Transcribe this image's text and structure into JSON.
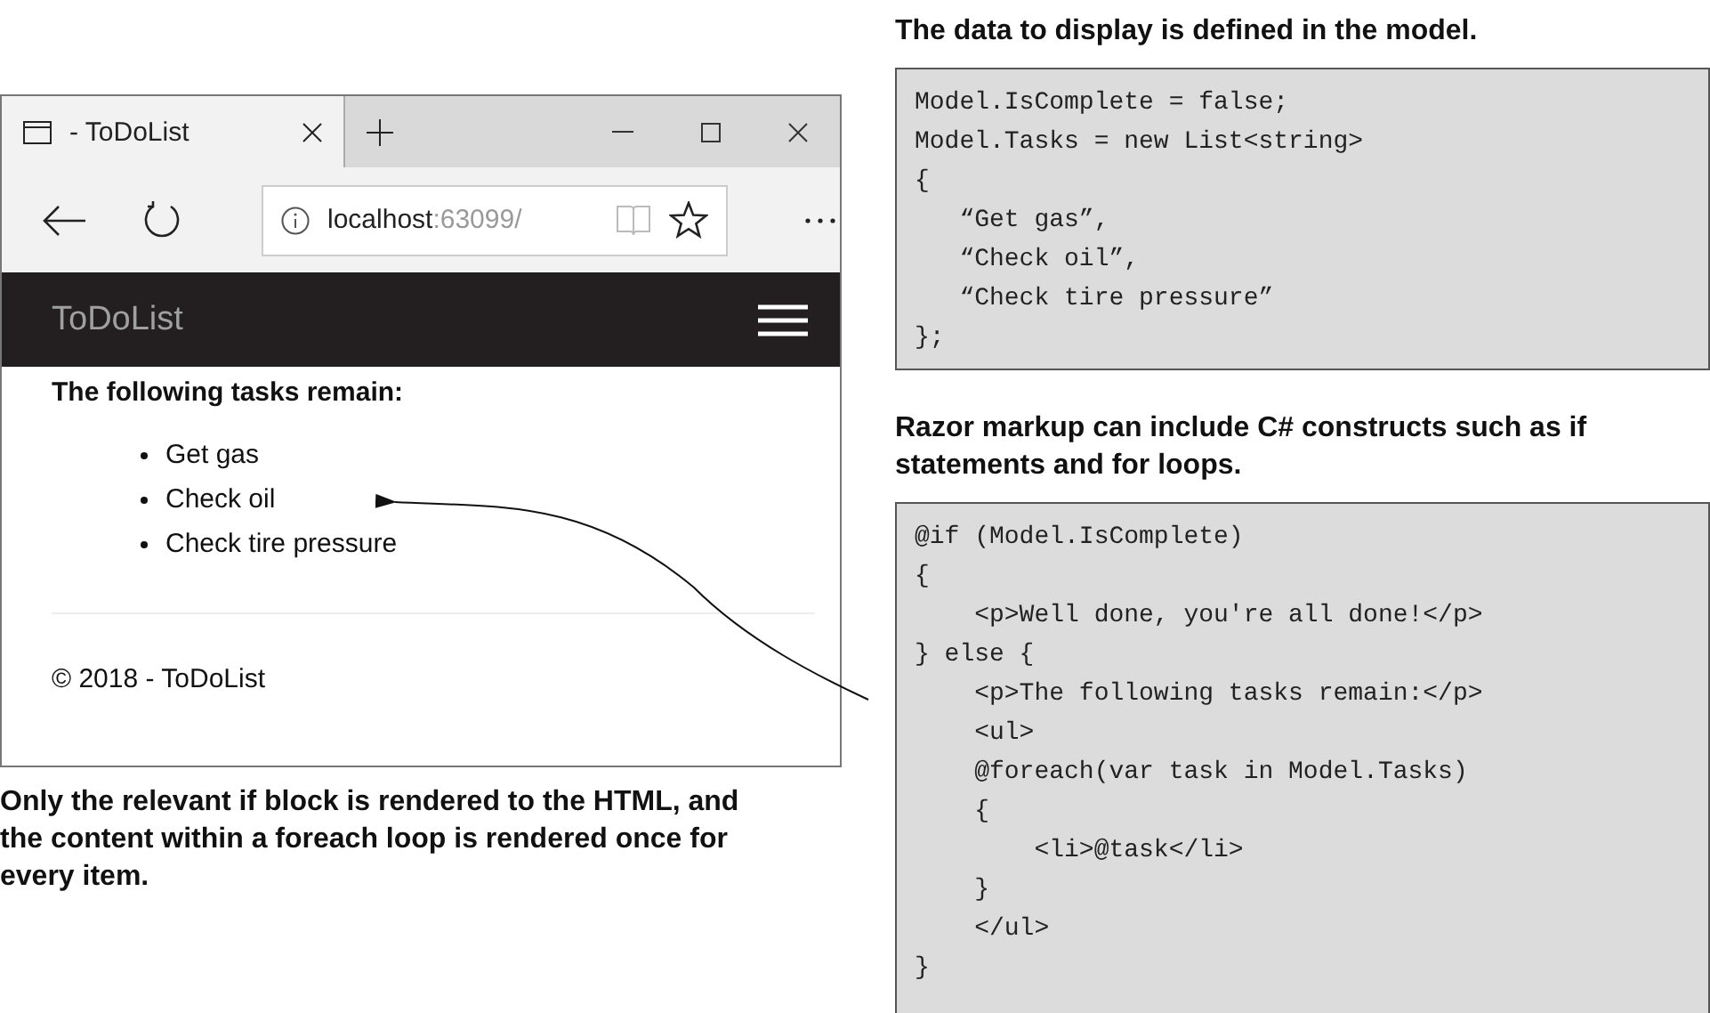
{
  "browser": {
    "tab": {
      "title": "- ToDoList",
      "selected": true
    },
    "address": {
      "host": "localhost",
      "port": ":63099/"
    },
    "navbar": {
      "brand": "ToDoList"
    },
    "page": {
      "heading": "The following tasks remain:",
      "tasks": [
        "Get gas",
        "Check oil",
        "Check tire pressure"
      ],
      "footer": "© 2018 - ToDoList"
    }
  },
  "browser_caption": "Only the relevant if block is rendered to the HTML, and the content within a foreach loop is rendered once for every item.",
  "model_panel": {
    "caption": "The data to display is defined in the model.",
    "code_lines": [
      "Model.IsComplete = false;",
      "Model.Tasks = new List<string>",
      "{",
      "   “Get gas”,",
      "   “Check oil”,",
      "   “Check tire pressure”",
      "};"
    ]
  },
  "razor_panel": {
    "caption": "Razor markup can include C# constructs such as if statements and for loops.",
    "code_lines": [
      "@if (Model.IsComplete)",
      "{",
      "    <p>Well done, you're all done!</p>",
      "} else {",
      "    <p>The following tasks remain:</p>",
      "    <ul>",
      "    @foreach(var task in Model.Tasks)",
      "    {",
      "        <li>@task</li>",
      "    }",
      "    </ul>",
      "}"
    ]
  }
}
